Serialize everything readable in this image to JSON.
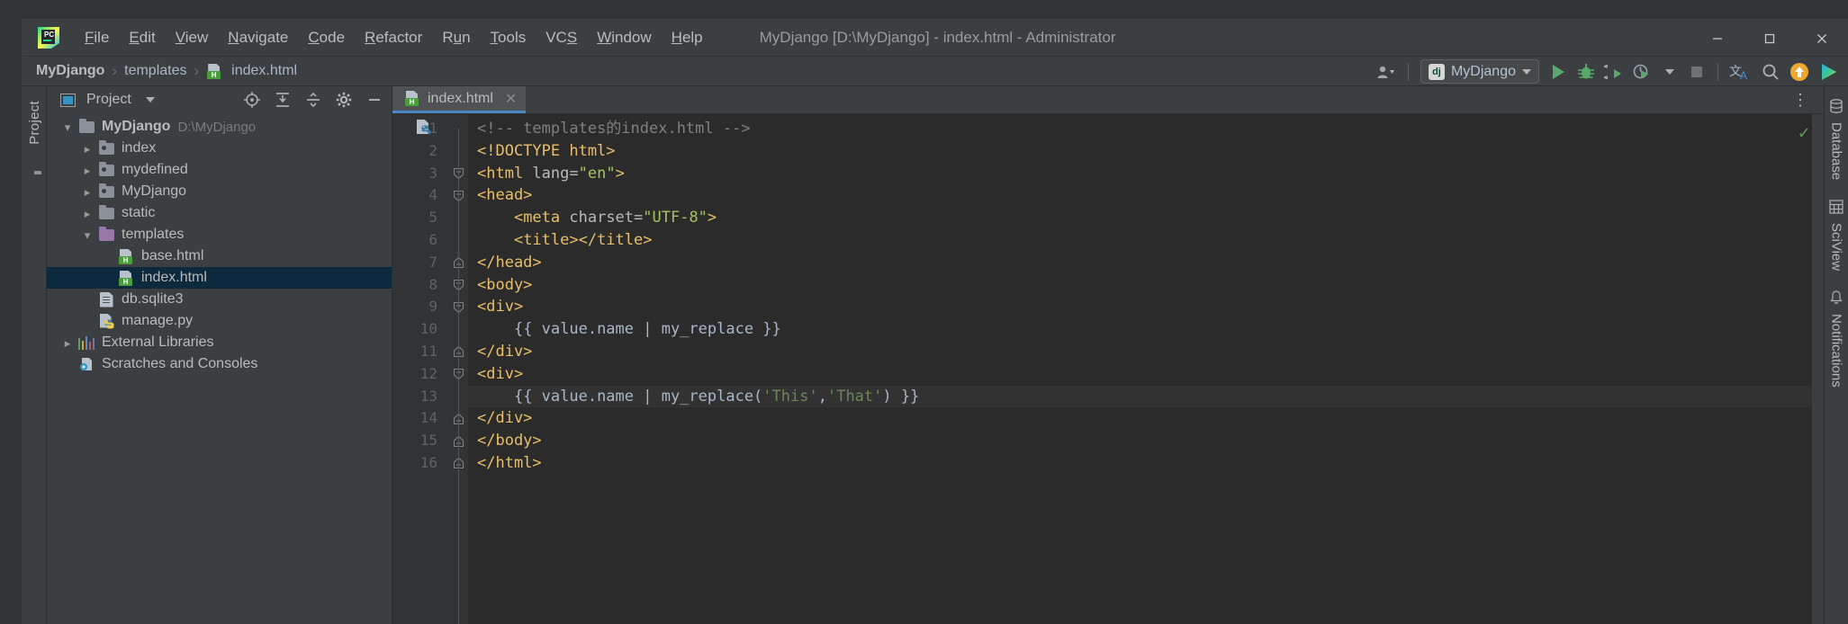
{
  "window": {
    "title": "MyDjango [D:\\MyDjango] - index.html - Administrator",
    "minimize_label": "—",
    "maximize_label": "☐",
    "close_label": "✕"
  },
  "menu": {
    "items": [
      {
        "label": "File",
        "mnemonic": "F"
      },
      {
        "label": "Edit",
        "mnemonic": "E"
      },
      {
        "label": "View",
        "mnemonic": "V"
      },
      {
        "label": "Navigate",
        "mnemonic": "N"
      },
      {
        "label": "Code",
        "mnemonic": "C"
      },
      {
        "label": "Refactor",
        "mnemonic": "R"
      },
      {
        "label": "Run",
        "mnemonic": "u"
      },
      {
        "label": "Tools",
        "mnemonic": "T"
      },
      {
        "label": "VCS",
        "mnemonic": "S"
      },
      {
        "label": "Window",
        "mnemonic": "W"
      },
      {
        "label": "Help",
        "mnemonic": "H"
      }
    ]
  },
  "navbar": {
    "breadcrumb": [
      "MyDjango",
      "templates",
      "index.html"
    ],
    "separator": "›",
    "run_config": "MyDjango",
    "run_config_icon": "django-icon",
    "icons": [
      "user-avatar-icon",
      "run-icon",
      "debug-icon",
      "coverage-icon",
      "profile-icon",
      "stop-icon",
      "translate-icon",
      "search-icon",
      "update-project-icon",
      "plugin-icon"
    ]
  },
  "left_strip": {
    "label": "Project",
    "bottom_icon": "structure-icon"
  },
  "project_panel": {
    "title": "Project",
    "header_icons": [
      "locate-icon",
      "expand-all-icon",
      "collapse-all-icon",
      "settings-gear-icon",
      "hide-icon"
    ],
    "tree": [
      {
        "label": "MyDjango",
        "sub": "D:\\MyDjango",
        "icon": "folder-root-icon",
        "arrow": "expanded",
        "indent": 0,
        "bold": true,
        "selected": false
      },
      {
        "label": "index",
        "sub": "",
        "icon": "folder-source-icon",
        "arrow": "collapsed",
        "indent": 1,
        "bold": false,
        "selected": false
      },
      {
        "label": "mydefined",
        "sub": "",
        "icon": "folder-source-icon",
        "arrow": "collapsed",
        "indent": 1,
        "bold": false,
        "selected": false
      },
      {
        "label": "MyDjango",
        "sub": "",
        "icon": "folder-source-icon",
        "arrow": "collapsed",
        "indent": 1,
        "bold": false,
        "selected": false
      },
      {
        "label": "static",
        "sub": "",
        "icon": "folder-icon",
        "arrow": "collapsed",
        "indent": 1,
        "bold": false,
        "selected": false
      },
      {
        "label": "templates",
        "sub": "",
        "icon": "folder-template-icon",
        "arrow": "expanded",
        "indent": 1,
        "bold": false,
        "selected": false
      },
      {
        "label": "base.html",
        "sub": "",
        "icon": "html-file-icon",
        "arrow": "none",
        "indent": 2,
        "bold": false,
        "selected": false
      },
      {
        "label": "index.html",
        "sub": "",
        "icon": "html-file-icon",
        "arrow": "none",
        "indent": 2,
        "bold": false,
        "selected": true
      },
      {
        "label": "db.sqlite3",
        "sub": "",
        "icon": "database-file-icon",
        "arrow": "none",
        "indent": 1,
        "bold": false,
        "selected": false
      },
      {
        "label": "manage.py",
        "sub": "",
        "icon": "python-file-icon",
        "arrow": "none",
        "indent": 1,
        "bold": false,
        "selected": false
      },
      {
        "label": "External Libraries",
        "sub": "",
        "icon": "libraries-icon",
        "arrow": "collapsed",
        "indent": 0,
        "bold": false,
        "selected": false
      },
      {
        "label": "Scratches and Consoles",
        "sub": "",
        "icon": "scratches-icon",
        "arrow": "none",
        "indent": 0,
        "bold": false,
        "selected": false
      }
    ]
  },
  "editor": {
    "tab": {
      "label": "index.html",
      "icon": "html-file-icon",
      "close": "✕"
    },
    "tabbar_menu": "⋮",
    "inspection_status": "✓",
    "file_type_badge": "python-badge-icon",
    "lines": [
      {
        "n": "1",
        "fold": "",
        "html": "<span class='tok-comment'>&lt;!-- templates的index.html --&gt;</span>",
        "highlight": false
      },
      {
        "n": "2",
        "fold": "",
        "html": "<span class='tok-tag'>&lt;!DOCTYPE html&gt;</span>",
        "highlight": false
      },
      {
        "n": "3",
        "fold": "minus-down",
        "html": "<span class='tok-tag'>&lt;html </span><span class='tok-attr'>lang=</span><span class='tok-val'>\"en\"</span><span class='tok-tag'>&gt;</span>",
        "highlight": false
      },
      {
        "n": "4",
        "fold": "minus-down",
        "html": "<span class='tok-tag'>&lt;head&gt;</span>",
        "highlight": false
      },
      {
        "n": "5",
        "fold": "",
        "html": "    <span class='tok-tag'>&lt;meta </span><span class='tok-attr'>charset=</span><span class='tok-val'>\"UTF-8\"</span><span class='tok-tag'>&gt;</span>",
        "highlight": false
      },
      {
        "n": "6",
        "fold": "",
        "html": "    <span class='tok-tag'>&lt;title&gt;&lt;/title&gt;</span>",
        "highlight": false
      },
      {
        "n": "7",
        "fold": "minus-up",
        "html": "<span class='tok-tag'>&lt;/head&gt;</span>",
        "highlight": false
      },
      {
        "n": "8",
        "fold": "minus-down",
        "html": "<span class='tok-tag'>&lt;body&gt;</span>",
        "highlight": false
      },
      {
        "n": "9",
        "fold": "minus-down",
        "html": "<span class='tok-tag'>&lt;div&gt;</span>",
        "highlight": false
      },
      {
        "n": "10",
        "fold": "",
        "html": "    <span class='tok-dj'>{{ value.name | my_replace }}</span>",
        "highlight": false
      },
      {
        "n": "11",
        "fold": "minus-up",
        "html": "<span class='tok-tag'>&lt;/div&gt;</span>",
        "highlight": false
      },
      {
        "n": "12",
        "fold": "minus-down",
        "html": "<span class='tok-tag'>&lt;div&gt;</span>",
        "highlight": false
      },
      {
        "n": "13",
        "fold": "",
        "html": "    <span class='tok-dj'>{{ value.name | my_replace(</span><span class='tok-djstr'>'This'</span><span class='tok-dj'>,</span><span class='tok-djstr'>'That'</span><span class='tok-dj'>) }}</span>",
        "highlight": true
      },
      {
        "n": "14",
        "fold": "minus-up",
        "html": "<span class='tok-tag'>&lt;/div&gt;</span>",
        "highlight": false
      },
      {
        "n": "15",
        "fold": "minus-up",
        "html": "<span class='tok-tag'>&lt;/body&gt;</span>",
        "highlight": false
      },
      {
        "n": "16",
        "fold": "minus-up",
        "html": "<span class='tok-tag'>&lt;/html&gt;</span>",
        "highlight": false
      }
    ],
    "plain_lines": [
      "<!-- templates的index.html -->",
      "<!DOCTYPE html>",
      "<html lang=\"en\">",
      "<head>",
      "    <meta charset=\"UTF-8\">",
      "    <title></title>",
      "</head>",
      "<body>",
      "<div>",
      "    {{ value.name | my_replace }}",
      "</div>",
      "<div>",
      "    {{ value.name | my_replace('This','That') }}",
      "</div>",
      "</body>",
      "</html>"
    ]
  },
  "right_strip": {
    "items": [
      {
        "label": "Database",
        "icon": "database-icon"
      },
      {
        "label": "SciView",
        "icon": "sciview-icon"
      },
      {
        "label": "Notifications",
        "icon": "notifications-icon"
      }
    ]
  },
  "colors": {
    "accent": "#4a88c7",
    "selection": "#0d293e",
    "editor_bg": "#2b2b2b",
    "panel_bg": "#3c3f41",
    "gutter_bg": "#313335",
    "tag": "#e8bf6a",
    "string": "#a5c261",
    "comment": "#808080",
    "text": "#a9b7c6",
    "run_green": "#4caf50",
    "update_orange": "#f5a623",
    "template_folder": "#9876aa"
  }
}
